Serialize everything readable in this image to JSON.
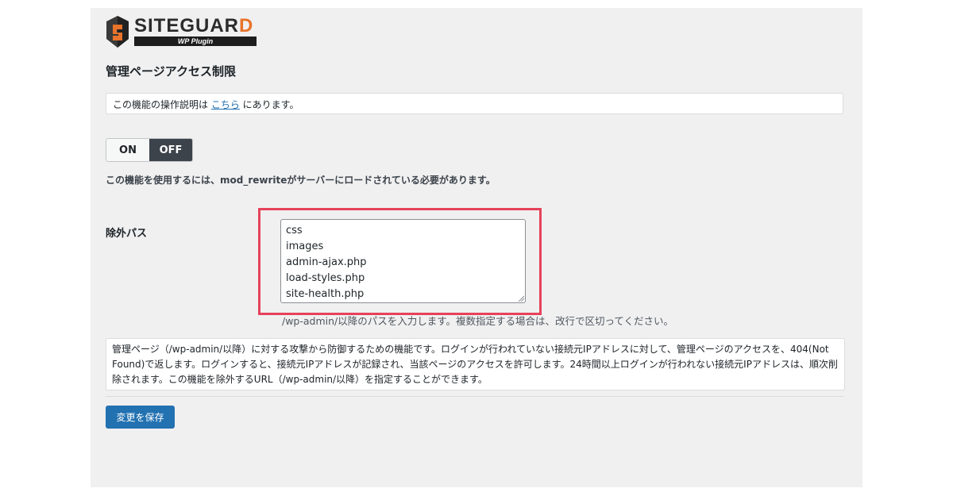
{
  "logo": {
    "name": "SITEGUARD",
    "name_main": "SITEGUAR",
    "name_last": "D",
    "subtitle": "WP Plugin"
  },
  "page": {
    "title": "管理ページアクセス制限"
  },
  "info": {
    "prefix": "この機能の操作説明は ",
    "link": "こちら",
    "suffix": " にあります。"
  },
  "toggle": {
    "on_label": "ON",
    "off_label": "OFF",
    "selected": "OFF"
  },
  "notice": "この機能を使用するには、mod_rewriteがサーバーにロードされている必要があります。",
  "exclude": {
    "label": "除外パス",
    "paths": [
      "css",
      "images",
      "admin-ajax.php",
      "load-styles.php",
      "site-health.php"
    ],
    "hint": "/wp-admin/以降のパスを入力します。複数指定する場合は、改行で区切ってください。"
  },
  "description": "管理ページ（/wp-admin/以降）に対する攻撃から防御するための機能です。ログインが行われていない接続元IPアドレスに対して、管理ページのアクセスを、404(Not Found)で返します。ログインすると、接続元IPアドレスが記録され、当該ページのアクセスを許可します。24時間以上ログインが行われない接続元IPアドレスは、順次削除されます。この機能を除外するURL（/wp-admin/以降）を指定することができます。",
  "save_button": "変更を保存",
  "colors": {
    "primary": "#2271b1",
    "toggle_active": "#3c434a",
    "highlight": "#e6425a",
    "logo_accent": "#e8732a"
  }
}
